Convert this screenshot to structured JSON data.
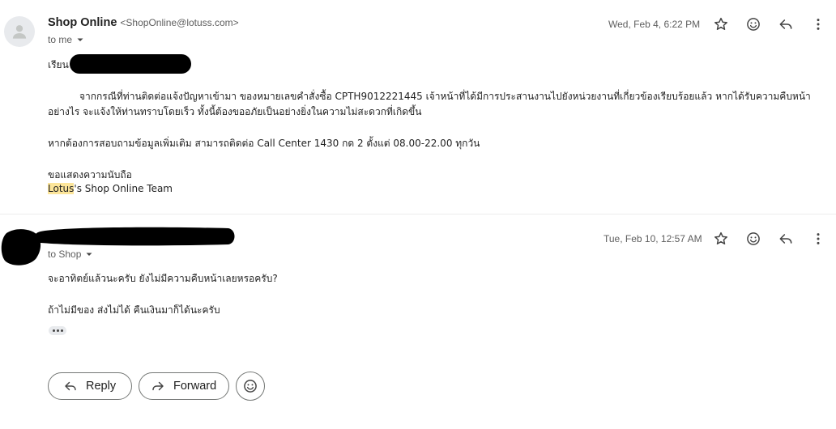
{
  "message1": {
    "sender_name": "Shop Online",
    "sender_email": "<ShopOnline@lotuss.com>",
    "to_label": "to me",
    "date": "Wed, Feb 4, 6:22 PM",
    "greeting": "เรียน",
    "para1_line1": "จากกรณีที่ท่านติดต่อแจ้งปัญหาเข้ามา ของหมายเลขคำสั่งซื้อ CPTH9012221445 เจ้าหน้าที่ได้มีการประสานงานไปยังหน่วยงานที่เกี่ยวข้องเรียบร้อยแล้ว หากได้รับความคืบหน้า",
    "para1_line2": "อย่างไร จะแจ้งให้ท่านทราบโดยเร็ว ทั้งนี้ต้องขออภัยเป็นอย่างยิ่งในความไม่สะดวกที่เกิดขึ้น",
    "para2": "หากต้องการสอบถามข้อมูลเพิ่มเติม สามารถติดต่อ Call Center 1430 กด 2 ตั้งแต่ 08.00-22.00 ทุกวัน",
    "closing": "ขอแสดงความนับถือ",
    "signature_highlight": "Lotus",
    "signature_rest": "'s Shop Online Team"
  },
  "message2": {
    "to_label": "to Shop",
    "date": "Tue, Feb 10, 12:57 AM",
    "line1": "จะอาทิตย์แล้วนะครับ ยังไม่มีความคืบหน้าเลยหรอครับ?",
    "line2": "ถ้าไม่มีของ ส่งไม่ได้ คืนเงินมาก็ได้นะครับ"
  },
  "actions": {
    "reply_label": "Reply",
    "forward_label": "Forward"
  },
  "icons": {
    "star": "star-icon",
    "emoji": "emoji-icon",
    "reply": "reply-icon",
    "more": "more-vert-icon",
    "forward": "forward-icon",
    "avatar": "person-icon",
    "dropdown": "caret-down-icon"
  },
  "colors": {
    "highlight": "#fce59a",
    "secondary_text": "#5e5e5e",
    "redaction": "#000000"
  }
}
